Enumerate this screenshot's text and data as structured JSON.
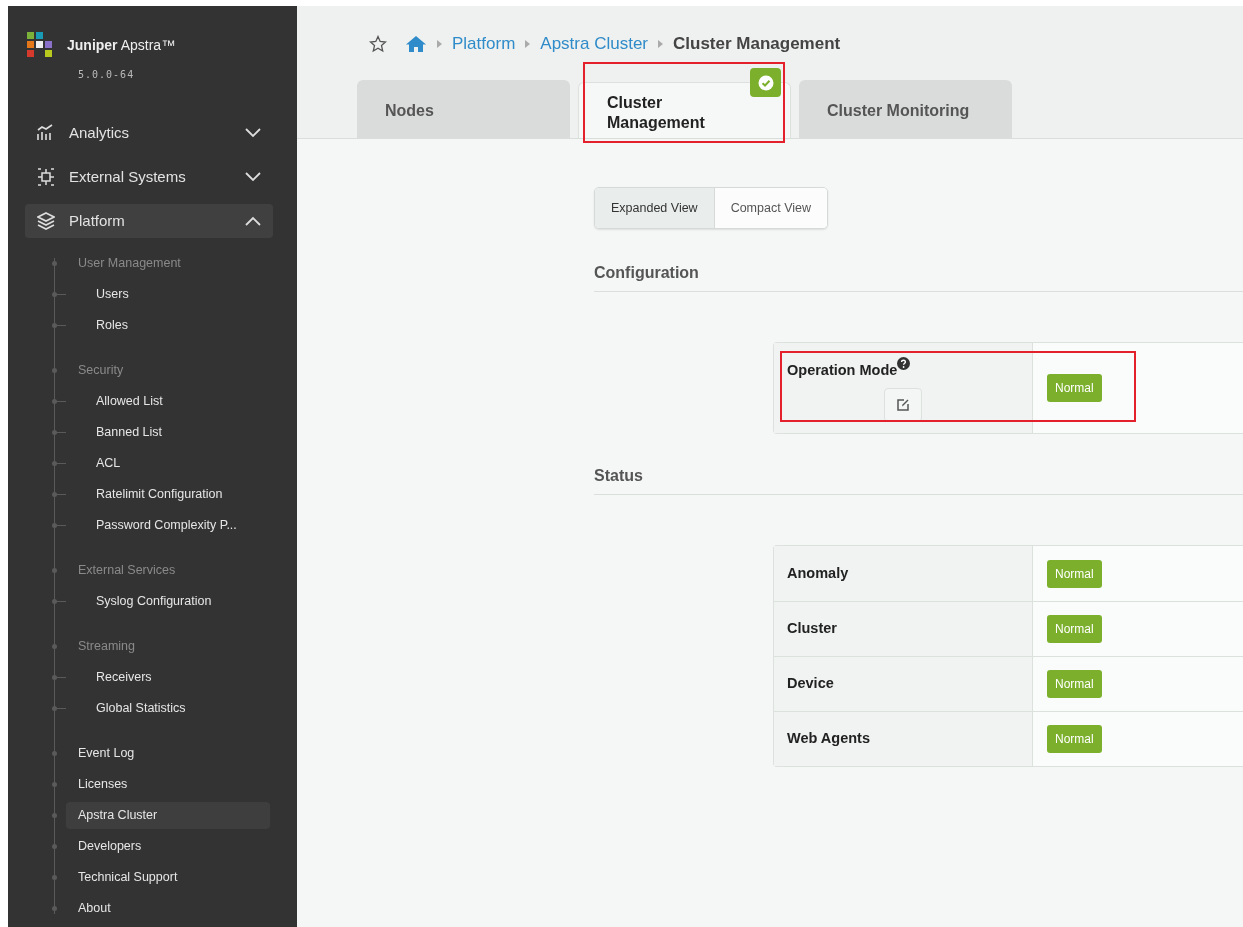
{
  "brand": {
    "name": "**Juniper** Apstra™",
    "version": "5.0.0-64"
  },
  "nav": [
    {
      "label": "Analytics",
      "expanded": false
    },
    {
      "label": "External Systems",
      "expanded": false
    },
    {
      "label": "Platform",
      "expanded": true
    }
  ],
  "platform_tree": [
    {
      "kind": "group",
      "label": "User Management",
      "children": [
        {
          "label": "Users",
          "selected": false
        },
        {
          "label": "Roles",
          "selected": false
        }
      ]
    },
    {
      "kind": "group",
      "label": "Security",
      "children": [
        {
          "label": "Allowed List",
          "selected": false
        },
        {
          "label": "Banned List",
          "selected": false
        },
        {
          "label": "ACL",
          "selected": false
        },
        {
          "label": "Ratelimit Configuration",
          "selected": false
        },
        {
          "label": "Password Complexity P...",
          "selected": false
        }
      ]
    },
    {
      "kind": "group",
      "label": "External Services",
      "children": [
        {
          "label": "Syslog Configuration",
          "selected": false
        }
      ]
    },
    {
      "kind": "group",
      "label": "Streaming",
      "children": [
        {
          "label": "Receivers",
          "selected": false
        },
        {
          "label": "Global Statistics",
          "selected": false
        }
      ]
    },
    {
      "kind": "link",
      "label": "Event Log",
      "selected": false
    },
    {
      "kind": "link",
      "label": "Licenses",
      "selected": false
    },
    {
      "kind": "link",
      "label": "Apstra Cluster",
      "selected": true
    },
    {
      "kind": "link",
      "label": "Developers",
      "selected": false
    },
    {
      "kind": "link",
      "label": "Technical Support",
      "selected": false
    },
    {
      "kind": "link",
      "label": "About",
      "selected": false
    }
  ],
  "breadcrumb": [
    {
      "kind": "link",
      "label": "Platform"
    },
    {
      "kind": "link",
      "label": "Apstra Cluster"
    },
    {
      "kind": "current",
      "label": "Cluster Management"
    }
  ],
  "tabs": [
    {
      "label": "Nodes",
      "selected": false,
      "checked": false,
      "highlighted": false
    },
    {
      "label": "Cluster Management",
      "selected": true,
      "checked": true,
      "highlighted": true
    },
    {
      "label": "Cluster Monitoring",
      "selected": false,
      "checked": false,
      "highlighted": false
    }
  ],
  "view_toggle": [
    {
      "label": "Expanded View",
      "selected": true
    },
    {
      "label": "Compact View",
      "selected": false
    }
  ],
  "sections": [
    {
      "title": "Configuration",
      "rows": [
        {
          "label": "Operation Mode",
          "help": true,
          "editable": true,
          "status": "Normal",
          "highlighted": true
        }
      ]
    },
    {
      "title": "Status",
      "rows": [
        {
          "label": "Anomaly",
          "help": false,
          "editable": false,
          "status": "Normal",
          "highlighted": false
        },
        {
          "label": "Cluster",
          "help": false,
          "editable": false,
          "status": "Normal",
          "highlighted": false
        },
        {
          "label": "Device",
          "help": false,
          "editable": false,
          "status": "Normal",
          "highlighted": false
        },
        {
          "label": "Web Agents",
          "help": false,
          "editable": false,
          "status": "Normal",
          "highlighted": false
        }
      ]
    }
  ]
}
